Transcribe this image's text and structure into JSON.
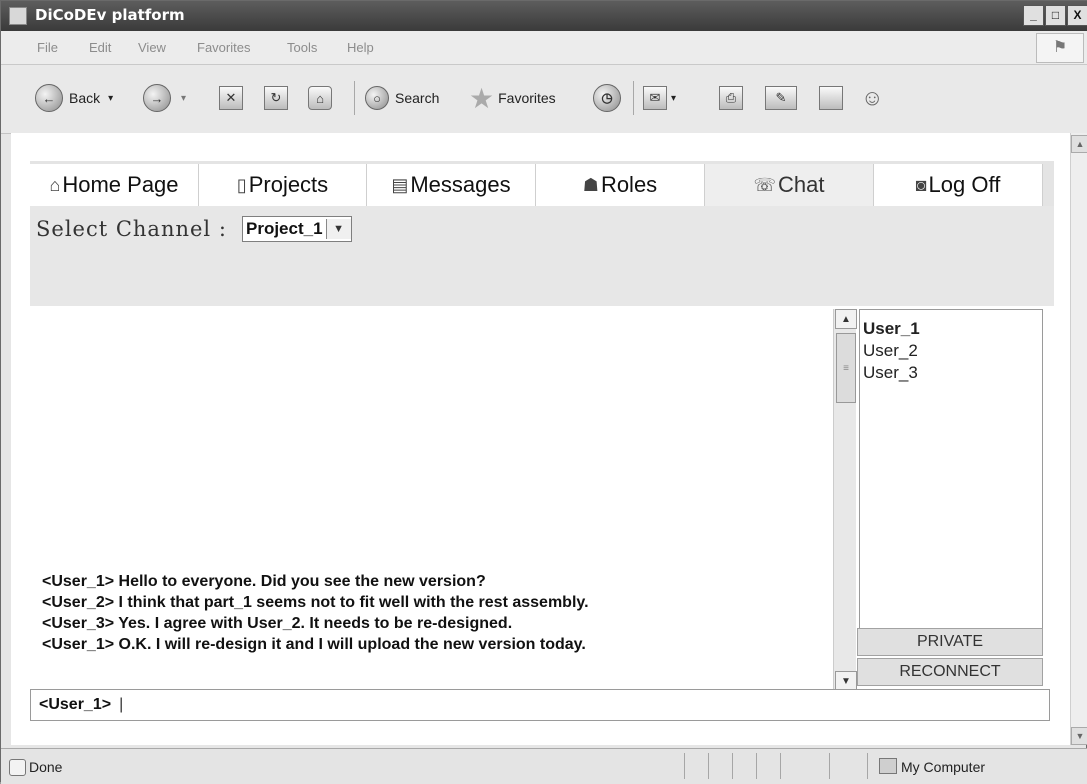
{
  "window": {
    "title": "DiCoDEv platform",
    "min": "_",
    "max": "□",
    "close": "X"
  },
  "menu": [
    "File",
    "Edit",
    "View",
    "Favorites",
    "Tools",
    "Help"
  ],
  "toolbar": {
    "back": "Back",
    "search": "Search",
    "favorites": "Favorites"
  },
  "tabs": [
    {
      "label": "Home Page",
      "icon": "⌂"
    },
    {
      "label": "Projects",
      "icon": "▯"
    },
    {
      "label": "Messages",
      "icon": "▤"
    },
    {
      "label": "Roles",
      "icon": "☗"
    },
    {
      "label": "Chat",
      "icon": "☏"
    },
    {
      "label": "Log Off",
      "icon": "◙"
    }
  ],
  "channel": {
    "label": "Select Channel :",
    "value": "Project_1"
  },
  "messages": [
    "<User_1> Hello to everyone. Did you see the new version?",
    "<User_2> I think that part_1 seems not to fit well with the rest assembly.",
    "<User_3> Yes. I agree with User_2. It needs to be re-designed.",
    "<User_1> O.K. I will re-design it and I will upload the new version today."
  ],
  "users": [
    "User_1",
    "User_2",
    "User_3"
  ],
  "buttons": {
    "private": "PRIVATE",
    "reconnect": "RECONNECT"
  },
  "input": {
    "prefix": "<User_1>",
    "caret": "|"
  },
  "status": {
    "text": "Done",
    "zone": "My Computer"
  }
}
